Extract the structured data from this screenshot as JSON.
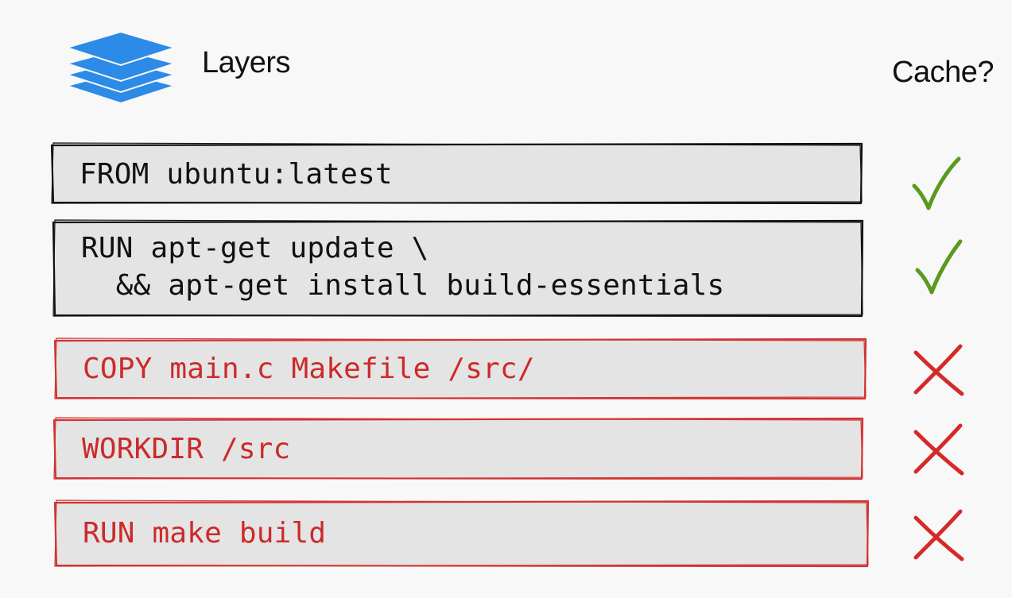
{
  "header": {
    "title": "Layers",
    "cache_label": "Cache?"
  },
  "icons": {
    "logo": "layers-stack-icon",
    "cached": "checkmark-icon",
    "not_cached": "cross-icon"
  },
  "colors": {
    "background": "#f8f8f8",
    "layer_fill": "#e4e4e4",
    "cached_border": "#111111",
    "uncached_border": "#d23333",
    "cached_text": "#111111",
    "uncached_text": "#cc2a2a",
    "check": "#5a9a1e",
    "cross": "#d52a2a",
    "logo_blue": "#2b8be6"
  },
  "layers": [
    {
      "lines": [
        "FROM ubuntu:latest"
      ],
      "cached": true
    },
    {
      "lines": [
        "RUN apt-get update \\",
        "  && apt-get install build-essentials"
      ],
      "cached": true
    },
    {
      "lines": [
        "COPY main.c Makefile /src/"
      ],
      "cached": false
    },
    {
      "lines": [
        "WORKDIR /src"
      ],
      "cached": false
    },
    {
      "lines": [
        "RUN make build"
      ],
      "cached": false
    }
  ]
}
